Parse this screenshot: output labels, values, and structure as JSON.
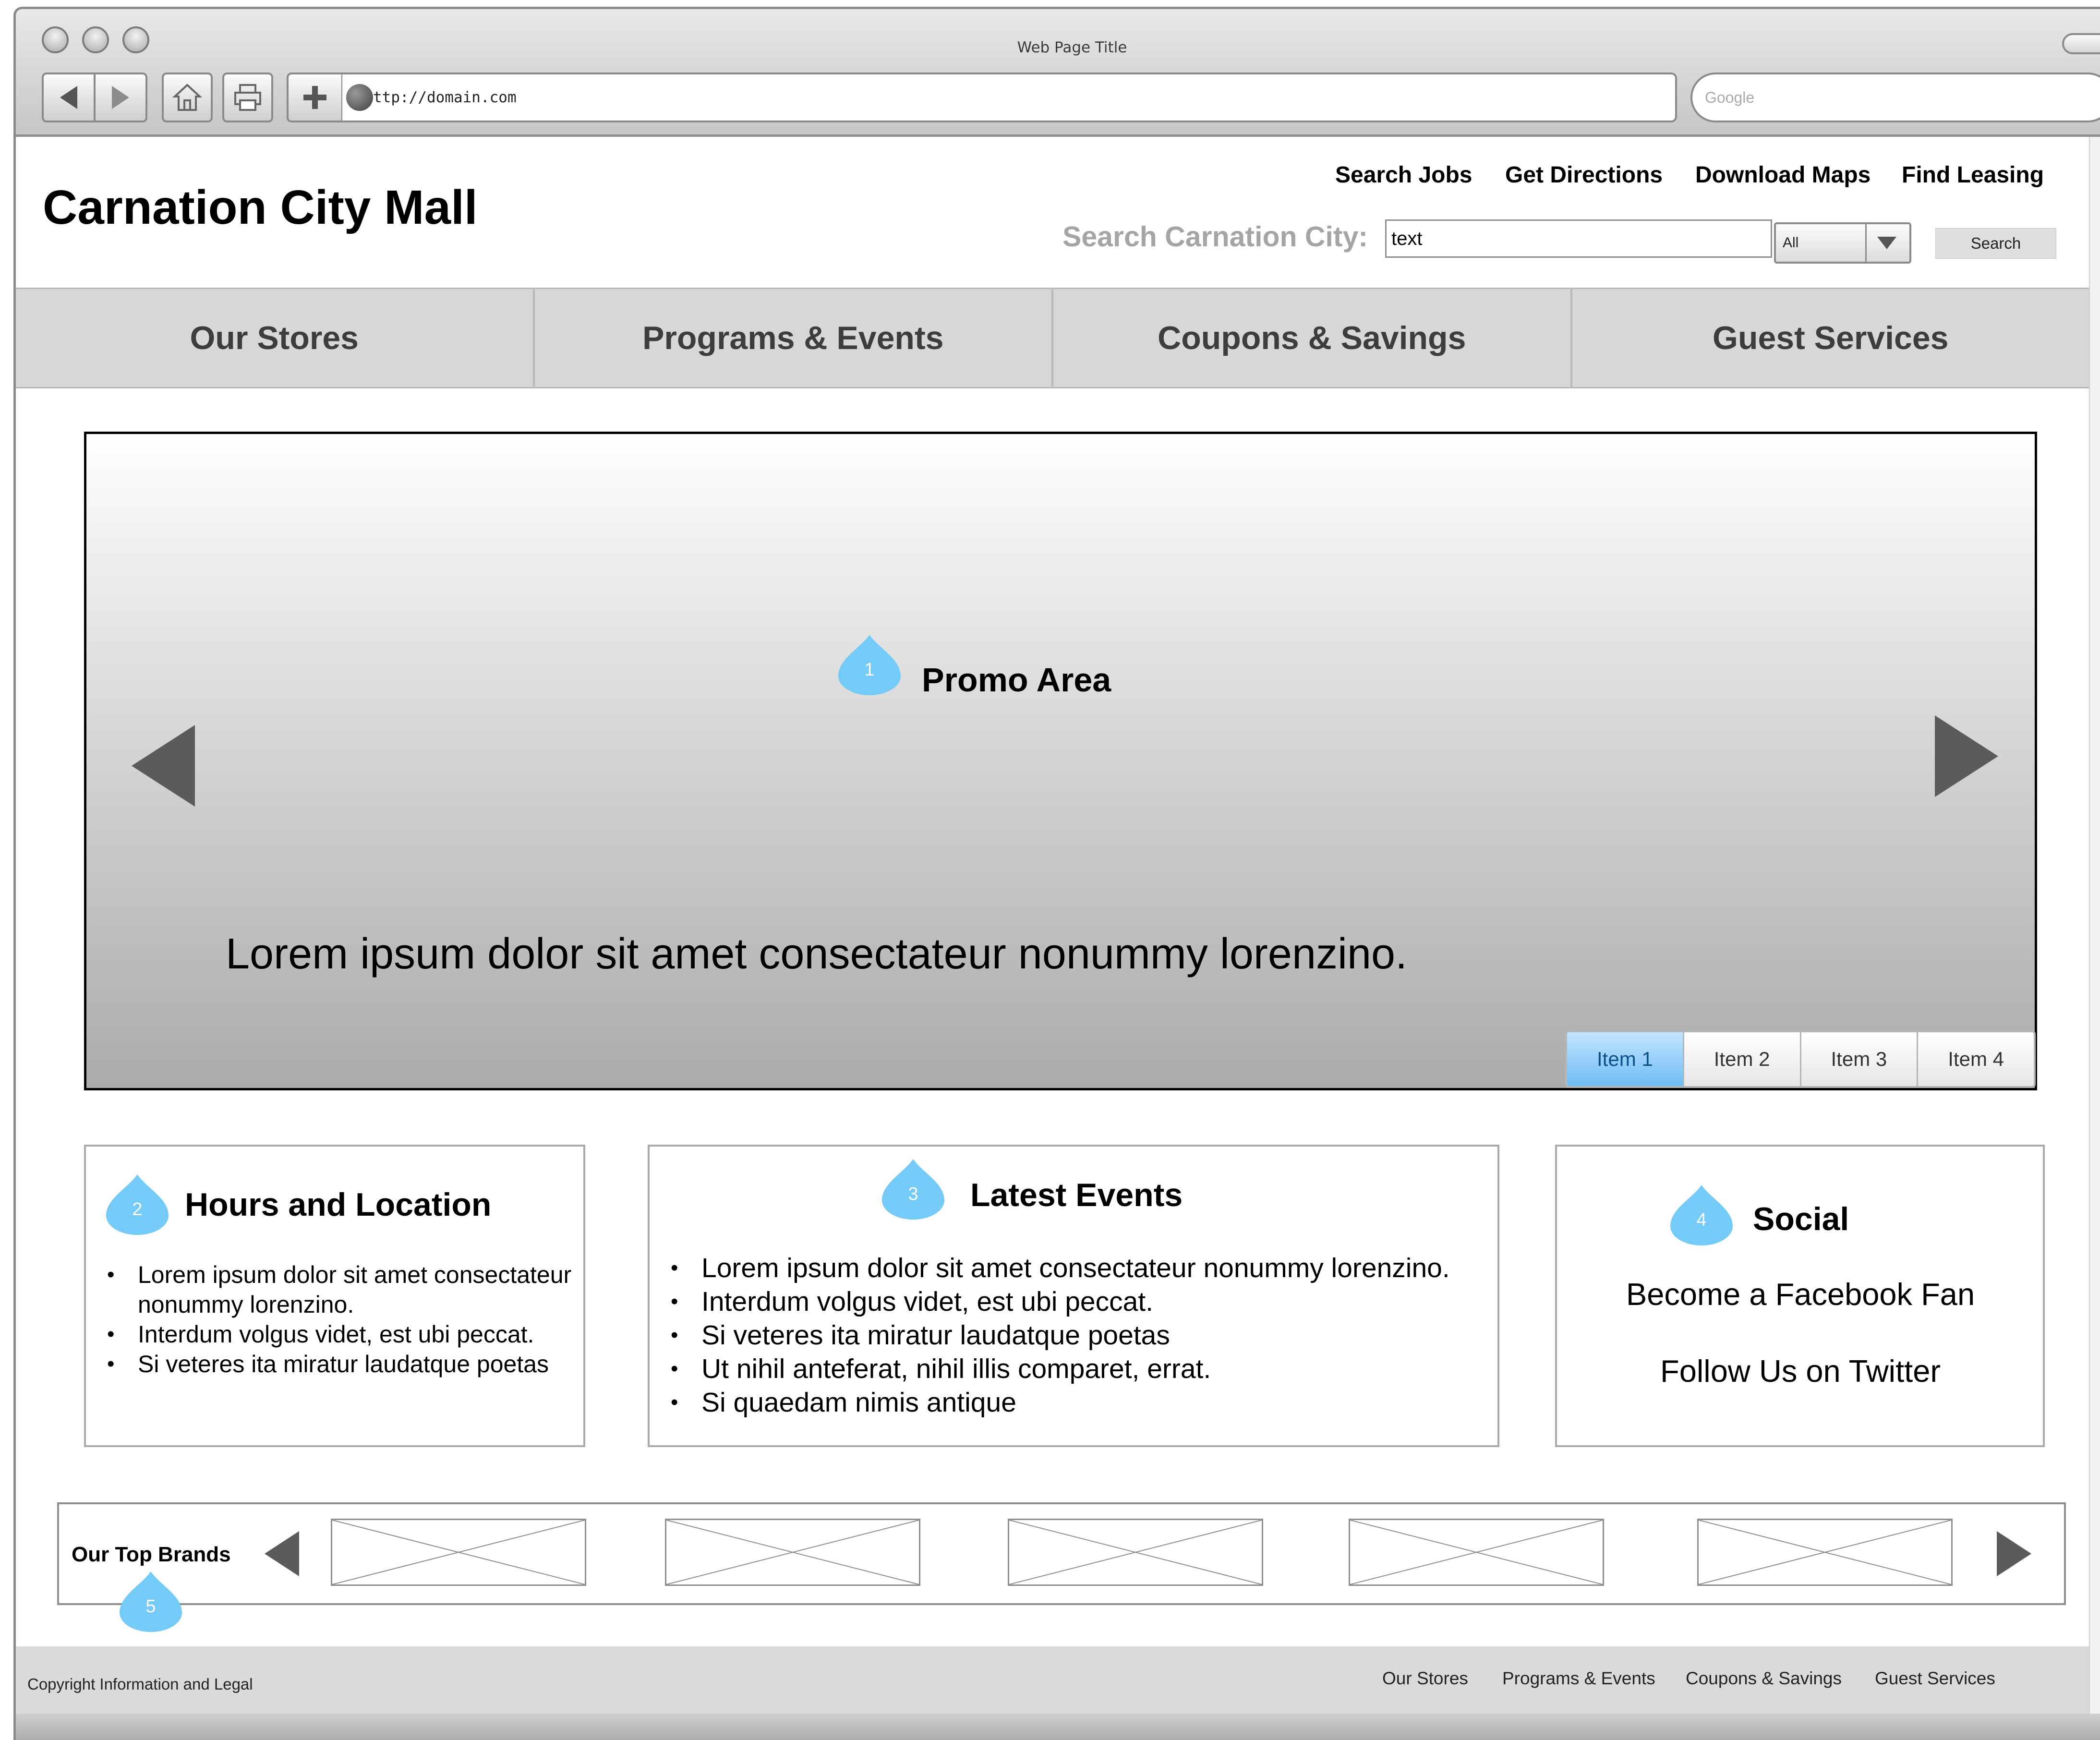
{
  "browser": {
    "window_title": "Web Page Title",
    "url": "ttp://domain.com",
    "search_placeholder": "Google"
  },
  "header": {
    "site_title": "Carnation City Mall",
    "top_links": [
      "Search Jobs",
      "Get Directions",
      "Download Maps",
      "Find Leasing"
    ],
    "search_label": "Search Carnation City:",
    "search_value": "text",
    "scope_value": "All",
    "search_button": "Search"
  },
  "nav": {
    "tabs": [
      "Our Stores",
      "Programs & Events",
      "Coupons & Savings",
      "Guest Services"
    ]
  },
  "promo": {
    "marker": "1",
    "heading": "Promo Area",
    "text": "Lorem ipsum dolor sit amet consectateur nonummy lorenzino.",
    "tabs": [
      "Item 1",
      "Item 2",
      "Item 3",
      "Item 4"
    ],
    "active_tab": "Item 1"
  },
  "hours": {
    "marker": "2",
    "title": "Hours and Location",
    "items": [
      "Lorem ipsum dolor sit amet consectateur nonummy lorenzino.",
      "Interdum volgus videt, est ubi peccat.",
      "Si veteres ita miratur laudatque poetas"
    ]
  },
  "events": {
    "marker": "3",
    "title": "Latest Events",
    "items": [
      "Lorem ipsum dolor sit amet consectateur nonummy lorenzino.",
      "Interdum volgus videt, est ubi peccat.",
      "Si veteres ita miratur laudatque poetas",
      "Ut nihil anteferat, nihil illis comparet, errat.",
      "Si quaedam nimis antique"
    ]
  },
  "social": {
    "marker": "4",
    "title": "Social",
    "facebook": "Become a Facebook Fan",
    "twitter": "Follow Us on Twitter"
  },
  "brands": {
    "marker": "5",
    "title": "Our Top Brands",
    "image_count": 5
  },
  "footer": {
    "copyright": "Copyright Information and Legal",
    "links": [
      "Our Stores",
      "Programs & Events",
      "Coupons & Savings",
      "Guest Services"
    ]
  },
  "colors": {
    "marker_blue": "#74cbf7",
    "active_tab": "#6fbdf5",
    "nav_bg": "#d7d7d7",
    "muted_label": "#a5a5a5"
  }
}
